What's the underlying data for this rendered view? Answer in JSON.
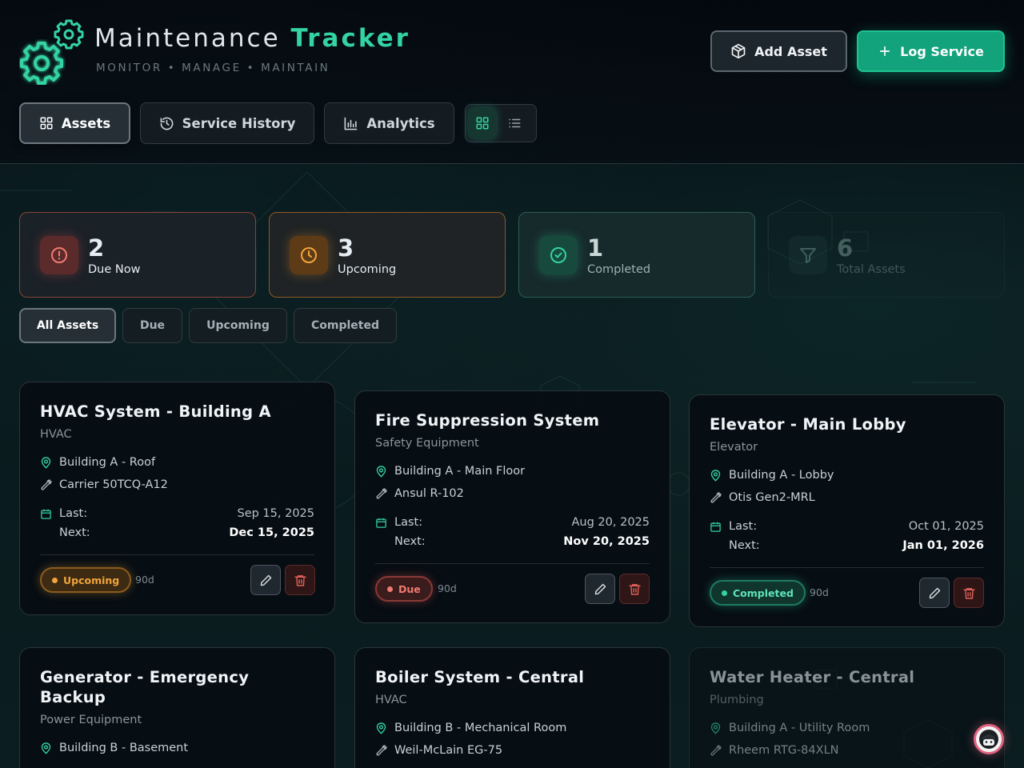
{
  "app": {
    "title_main": "Maintenance",
    "title_accent": "Tracker",
    "subtitle": "MONITOR • MANAGE • MAINTAIN",
    "accent_color": "#34d3a2"
  },
  "actions": {
    "add_asset": "Add Asset",
    "log_service": "Log Service"
  },
  "tabs": [
    {
      "label": "Assets",
      "icon": "grid-icon",
      "active": true
    },
    {
      "label": "Service History",
      "icon": "history-icon",
      "active": false
    },
    {
      "label": "Analytics",
      "icon": "bar-chart-icon",
      "active": false
    }
  ],
  "view_toggle": {
    "grid_icon": "grid-icon",
    "list_icon": "list-icon",
    "active": "grid"
  },
  "stats": {
    "due": {
      "value": "2",
      "label": "Due Now",
      "color": "#e05a5a",
      "icon": "alert-circle-icon"
    },
    "upcoming": {
      "value": "3",
      "label": "Upcoming",
      "color": "#f0a030",
      "icon": "clock-icon"
    },
    "completed": {
      "value": "1",
      "label": "Completed",
      "color": "#34d3a2",
      "icon": "check-circle-icon"
    },
    "total": {
      "value": "6",
      "label": "Total Assets",
      "icon": "filter-icon"
    }
  },
  "filters": [
    {
      "label": "All Assets",
      "active": true
    },
    {
      "label": "Due",
      "active": false
    },
    {
      "label": "Upcoming",
      "active": false
    },
    {
      "label": "Completed",
      "active": false
    }
  ],
  "cards": [
    {
      "name": "HVAC System - Building A",
      "category": "HVAC",
      "location": "Building A - Roof",
      "model": "Carrier 50TCQ-A12",
      "last_label": "Last:",
      "last_date": "Sep 15, 2025",
      "next_label": "Next:",
      "next_date": "Dec 15, 2025",
      "status": "Upcoming",
      "interval": "90d"
    },
    {
      "name": "Fire Suppression System",
      "category": "Safety Equipment",
      "location": "Building A - Main Floor",
      "model": "Ansul R-102",
      "last_label": "Last:",
      "last_date": "Aug 20, 2025",
      "next_label": "Next:",
      "next_date": "Nov 20, 2025",
      "status": "Due",
      "interval": "90d"
    },
    {
      "name": "Elevator - Main Lobby",
      "category": "Elevator",
      "location": "Building A - Lobby",
      "model": "Otis Gen2-MRL",
      "last_label": "Last:",
      "last_date": "Oct 01, 2025",
      "next_label": "Next:",
      "next_date": "Jan 01, 2026",
      "status": "Completed",
      "interval": "90d"
    },
    {
      "name_line1": "Generator - Emergency",
      "name_line2": "Backup",
      "category": "Power Equipment",
      "location": "Building B - Basement"
    },
    {
      "name": "Boiler System - Central",
      "category": "HVAC",
      "location": "Building B - Mechanical Room",
      "model": "Weil-McLain EG-75"
    },
    {
      "name": "Water Heater - Central",
      "category": "Plumbing",
      "location": "Building A - Utility Room",
      "model": "Rheem RTG-84XLN"
    }
  ]
}
